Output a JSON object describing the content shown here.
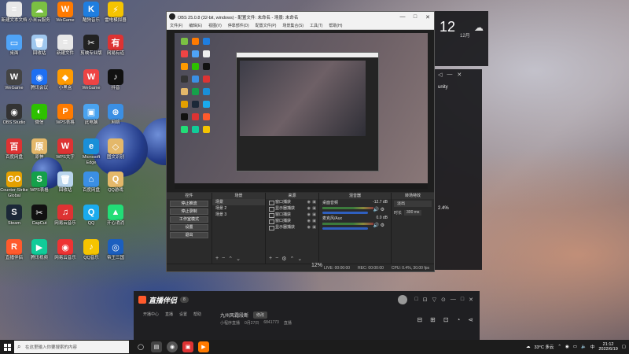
{
  "desktop_icons": [
    {
      "label": "新建文本文档",
      "color": "#e8e8e8",
      "glyph": "≡"
    },
    {
      "label": "小米云服务",
      "color": "#7bc043",
      "glyph": "☁"
    },
    {
      "label": "WeGame",
      "color": "#ff7a00",
      "glyph": "W"
    },
    {
      "label": "酷狗音乐",
      "color": "#1f7ee0",
      "glyph": "K"
    },
    {
      "label": "雷电模拟器",
      "color": "#f5c400",
      "glyph": "⚡"
    },
    {
      "label": "桌面",
      "color": "#4fa3f7",
      "glyph": "▭"
    },
    {
      "label": "回收站",
      "color": "#9fc7ee",
      "glyph": "🗑"
    },
    {
      "label": "新建文件",
      "color": "#e8e8e8",
      "glyph": "≡"
    },
    {
      "label": "剪映专业版",
      "color": "#222222",
      "glyph": "✂"
    },
    {
      "label": "网易有道",
      "color": "#d33",
      "glyph": "有"
    },
    {
      "label": "WeGame",
      "color": "#444",
      "glyph": "W"
    },
    {
      "label": "腾讯会议",
      "color": "#1d6ff2",
      "glyph": "◉"
    },
    {
      "label": "小黑盒",
      "color": "#ff9b00",
      "glyph": "◆"
    },
    {
      "label": "WeGame",
      "color": "#e44",
      "glyph": "W"
    },
    {
      "label": "抖音",
      "color": "#111",
      "glyph": "♪"
    },
    {
      "label": "OBS Studio",
      "color": "#333",
      "glyph": "◉"
    },
    {
      "label": "微信",
      "color": "#2dc100",
      "glyph": "◐"
    },
    {
      "label": "WPS表格",
      "color": "#ff7b00",
      "glyph": "P"
    },
    {
      "label": "此电脑",
      "color": "#4aa3f0",
      "glyph": "▣"
    },
    {
      "label": "网络",
      "color": "#3b8fe4",
      "glyph": "⊕"
    },
    {
      "label": "百度网盘",
      "color": "#d33",
      "glyph": "百"
    },
    {
      "label": "原神",
      "color": "#e4b86a",
      "glyph": "原"
    },
    {
      "label": "WPS文字",
      "color": "#d33",
      "glyph": "W"
    },
    {
      "label": "Microsoft Edge",
      "color": "#1a8fd8",
      "glyph": "e"
    },
    {
      "label": "图文识别",
      "color": "#e4b86a",
      "glyph": "◇"
    },
    {
      "label": "Counter-Strike Global",
      "color": "#e4a000",
      "glyph": "GO"
    },
    {
      "label": "WPS表格",
      "color": "#15a04a",
      "glyph": "S"
    },
    {
      "label": "回收站",
      "color": "#b8d4ec",
      "glyph": "🗑"
    },
    {
      "label": "百度网盘",
      "color": "#3b8fe4",
      "glyph": "⌂"
    },
    {
      "label": "QQ游戏",
      "color": "#e4b86a",
      "glyph": "Q"
    },
    {
      "label": "Steam",
      "color": "#1b2838",
      "glyph": "S"
    },
    {
      "label": "CapCut",
      "color": "#111",
      "glyph": "✂"
    },
    {
      "label": "网易云音乐",
      "color": "#d33",
      "glyph": "♫"
    },
    {
      "label": "QQ",
      "color": "#1aabee",
      "glyph": "Q"
    },
    {
      "label": "开心消消",
      "color": "#2d7",
      "glyph": "▲"
    },
    {
      "label": "直播伴侣",
      "color": "#ff5a2c",
      "glyph": "R"
    },
    {
      "label": "腾讯视频",
      "color": "#1c9",
      "glyph": "▶"
    },
    {
      "label": "网易云音乐",
      "color": "#e33",
      "glyph": "◉"
    },
    {
      "label": "QQ音乐",
      "color": "#f5c400",
      "glyph": "♪"
    },
    {
      "label": "帝王三国",
      "color": "#1b5fbf",
      "glyph": "◎"
    }
  ],
  "obs": {
    "title": "OBS 25.0.8 (32-bit, windows) - 配置文件: 未命名 - 场景: 未命名",
    "menu": [
      "文件(F)",
      "编辑(E)",
      "视图(V)",
      "停靠部件(D)",
      "配置文件(P)",
      "场景集合(S)",
      "工具(T)",
      "帮助(H)"
    ],
    "docks": {
      "controls_title": "控件",
      "controls": [
        "停止推流",
        "停止录制",
        "工作室模式",
        "设置",
        "退出"
      ],
      "scenes_title": "场景",
      "scenes": [
        "场景",
        "场景 2",
        "场景 3"
      ],
      "sources_title": "来源",
      "sources": [
        "窗口捕获",
        "显示器捕获",
        "窗口捕获",
        "窗口捕获",
        "显示器捕获"
      ],
      "mixer_title": "混音器",
      "mixer": [
        {
          "name": "桌面音频",
          "db": "-12.7 dB"
        },
        {
          "name": "麦克风/Aux",
          "db": "0.0 dB"
        }
      ],
      "transition_title": "转场特效",
      "transition": {
        "name": "淡出",
        "duration_label": "时长",
        "duration": "300 ms"
      }
    },
    "status": {
      "live": "LIVE: 00:00:00",
      "rec": "REC: 00:00:00",
      "cpu": "CPU: 0.4%, 30.00 fps"
    }
  },
  "preview_zoom": "12%",
  "clock_widget": {
    "hour": "12",
    "date": "12月"
  },
  "side_panel": {
    "brand": "unity",
    "percent": "2.4%"
  },
  "live_app": {
    "name": "直播伴侣",
    "badge": "8",
    "tabs": [
      "开播中心",
      "直播",
      "设置",
      "帮助"
    ],
    "room_title": "九州风霜段断",
    "room_btn": "修改",
    "meta": [
      "小程序直播",
      "0月27日",
      "6841773",
      "直播"
    ],
    "icons": [
      "□",
      "⊡",
      "▽",
      "⊙",
      "—",
      "□",
      "✕"
    ]
  },
  "taskbar": {
    "search_placeholder": "在这里输入你要搜索的内容",
    "weather": "33°C 多云",
    "lang": "中",
    "time": "21:12",
    "date": "2022/6/19"
  },
  "colors": {
    "accent": "#2f5fbf",
    "obs_bg": "#2b2b2b",
    "live_accent": "#ff5a2c"
  }
}
